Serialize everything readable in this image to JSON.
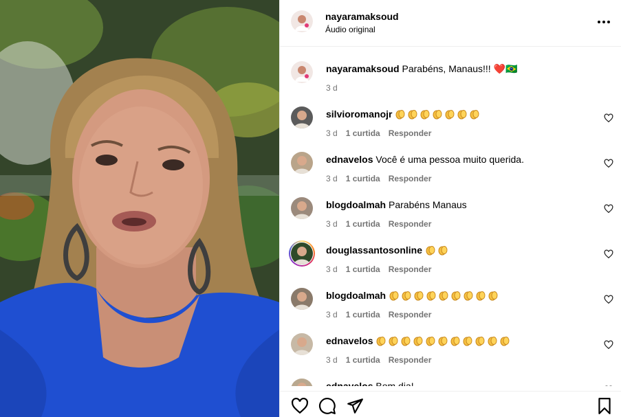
{
  "post": {
    "author": "nayaramaksoud",
    "audio": "Áudio original",
    "caption": {
      "user": "nayaramaksoud",
      "text": "Parabéns, Manaus!!! ",
      "emoji_suffix": "❤️🇧🇷",
      "time": "3 d"
    }
  },
  "comments": [
    {
      "user": "silvioromanojr",
      "text": "",
      "claps": 7,
      "time": "3 d",
      "likes": "1 curtida",
      "reply": "Responder"
    },
    {
      "user": "ednavelos",
      "text": "Você é uma pessoa muito querida.",
      "claps": 0,
      "time": "3 d",
      "likes": "1 curtida",
      "reply": "Responder"
    },
    {
      "user": "blogdoalmah",
      "text": "Parabéns Manaus",
      "claps": 0,
      "time": "3 d",
      "likes": "1 curtida",
      "reply": "Responder"
    },
    {
      "user": "douglassantosonline",
      "text": "",
      "claps": 2,
      "time": "3 d",
      "likes": "1 curtida",
      "reply": "Responder"
    },
    {
      "user": "blogdoalmah",
      "text": "",
      "claps": 9,
      "time": "3 d",
      "likes": "1 curtida",
      "reply": "Responder"
    },
    {
      "user": "ednavelos",
      "text": "",
      "claps": 11,
      "time": "3 d",
      "likes": "1 curtida",
      "reply": "Responder"
    },
    {
      "user": "ednavelos",
      "text": "Bom dia!",
      "claps": 0,
      "time": "",
      "likes": "",
      "reply": ""
    }
  ],
  "icons": {
    "more": "more-options-icon",
    "like": "heart-icon",
    "comment": "comment-icon",
    "share": "share-icon",
    "save": "bookmark-icon"
  },
  "colors": {
    "heart_red": "#ed4956",
    "meta_gray": "#737373",
    "dress_blue": "#1f4fd1"
  }
}
